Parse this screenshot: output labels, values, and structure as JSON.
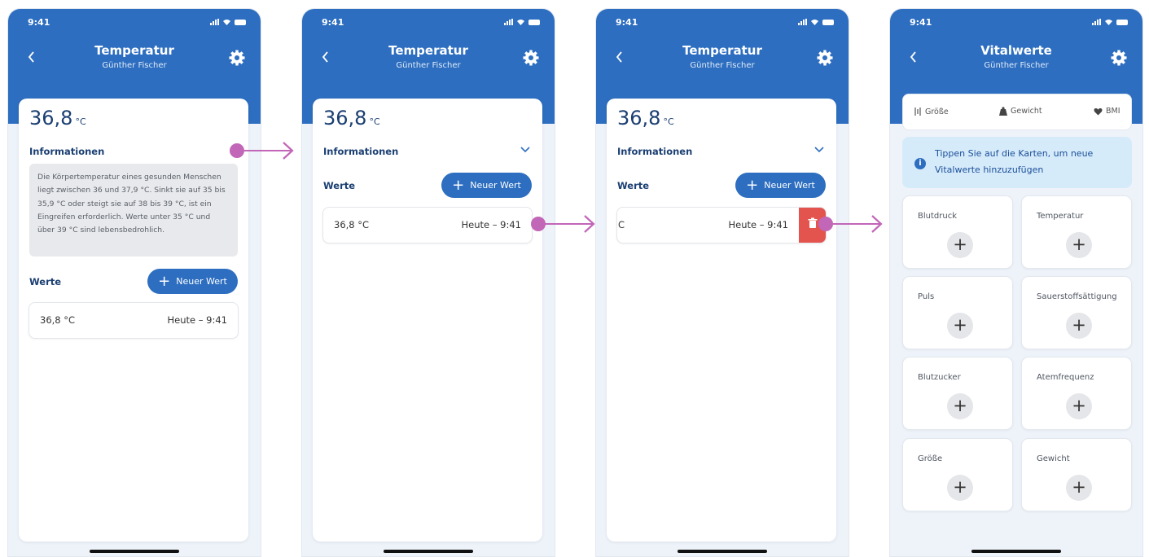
{
  "status": {
    "time": "9:41"
  },
  "screens": [
    {
      "title": "Temperatur",
      "subtitle": "Günther Fischer",
      "value": "36,8",
      "unit": "°C",
      "info_label": "Informationen",
      "info_text": "Die Körpertemperatur eines gesunden Menschen liegt zwischen 36 und 37,9 °C. Sinkt sie auf 35 bis 35,9 °C oder steigt sie auf 38 bis 39 °C, ist ein Eingreifen erforderlich. Werte unter 35 °C und über 39 °C sind lebensbedrohlich.",
      "werte_label": "Werte",
      "new_button": "Neuer Wert",
      "row_value": "36,8 °C",
      "row_time": "Heute – 9:41"
    },
    {
      "title": "Temperatur",
      "subtitle": "Günther Fischer",
      "value": "36,8",
      "unit": "°C",
      "info_label": "Informationen",
      "werte_label": "Werte",
      "new_button": "Neuer Wert",
      "row_value": "36,8 °C",
      "row_time": "Heute – 9:41"
    },
    {
      "title": "Temperatur",
      "subtitle": "Günther Fischer",
      "value": "36,8",
      "unit": "°C",
      "info_label": "Informationen",
      "werte_label": "Werte",
      "new_button": "Neuer Wert",
      "row_value_partial": "C",
      "row_time": "Heute – 9:41"
    },
    {
      "title": "Vitalwerte",
      "subtitle": "Günther Fischer",
      "tabs": [
        "Größe",
        "Gewicht",
        "BMI"
      ],
      "tip": "Tippen Sie auf die Karten, um neue Vitalwerte hinzuzufügen",
      "cards": [
        "Blutdruck",
        "Temperatur",
        "Puls",
        "Sauerstoffsättigung",
        "Blutzucker",
        "Atemfrequenz",
        "Größe",
        "Gewicht"
      ]
    }
  ],
  "colors": {
    "header": "#2d6ec0",
    "accent_arrow": "#c266b8",
    "delete": "#e4544e"
  }
}
